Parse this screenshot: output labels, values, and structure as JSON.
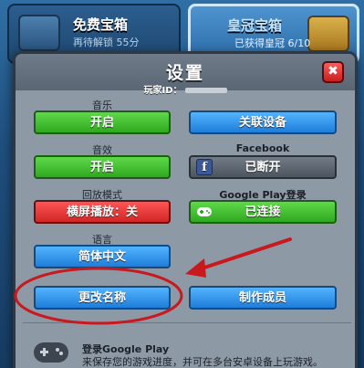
{
  "background": {
    "free_chest": {
      "title": "免费宝箱",
      "subtitle": "再待解锁 55分"
    },
    "crown_chest": {
      "title": "皇冠宝箱",
      "subtitle": "已获得皇冠",
      "progress_text": "6/10"
    }
  },
  "modal": {
    "title": "设置",
    "close_symbol": "✖",
    "player_id_label": "玩家ID："
  },
  "settings": {
    "music": {
      "label": "音乐",
      "button": "开启"
    },
    "sfx": {
      "label": "音效",
      "button": "开启"
    },
    "replay": {
      "label": "回放模式",
      "button": "横屏播放：关"
    },
    "language": {
      "label": "语言",
      "button": "简体中文"
    },
    "link_device": {
      "button": "关联设备"
    },
    "facebook": {
      "label": "Facebook",
      "button": "已断开",
      "icon": "f"
    },
    "google_play": {
      "label": "Google Play登录",
      "button": "已连接"
    },
    "rename": {
      "button": "更改名称"
    },
    "credits": {
      "button": "制作成员"
    }
  },
  "footer": {
    "title": "登录Google Play",
    "text": "来保存您的游戏进度，并可在多台安卓设备上玩游戏。"
  },
  "colors": {
    "green_button": "#2fa81f",
    "blue_button": "#1f7dd9",
    "gray_button": "#4c555e",
    "red_button": "#d02626",
    "annotation_red": "#c8191e"
  }
}
